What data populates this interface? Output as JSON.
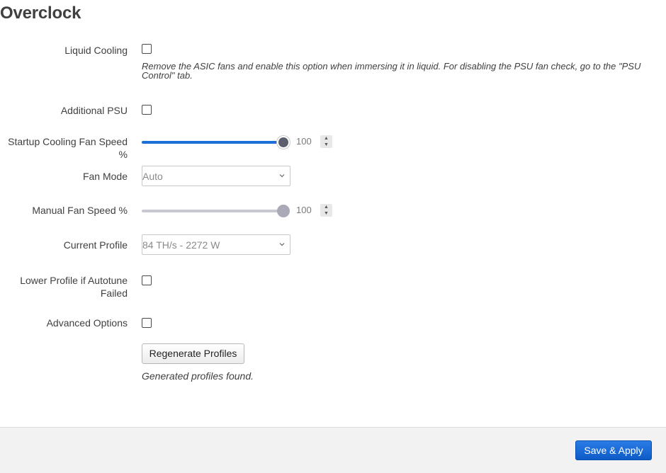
{
  "page": {
    "title": "Overclock"
  },
  "liquid_cooling": {
    "label": "Liquid Cooling",
    "checked": false,
    "description": "Remove the ASIC fans and enable this option when immersing it in liquid. For disabling the PSU fan check, go to the \"PSU Control\" tab."
  },
  "additional_psu": {
    "label": "Additional PSU",
    "checked": false
  },
  "startup_fan_speed": {
    "label": "Startup Cooling Fan Speed %",
    "value": "100",
    "level_percent": 100
  },
  "fan_mode": {
    "label": "Fan Mode",
    "selected": "Auto"
  },
  "manual_fan_speed": {
    "label": "Manual Fan Speed %",
    "value": "100",
    "level_percent": 100
  },
  "current_profile": {
    "label": "Current Profile",
    "selected": "84 TH/s - 2272 W"
  },
  "lower_profile": {
    "label_line1": "Lower Profile if Autotune",
    "label_line2": "Failed",
    "checked": false
  },
  "advanced_options": {
    "label": "Advanced Options",
    "checked": false
  },
  "regenerate": {
    "button_label": "Regenerate Profiles",
    "status": "Generated profiles found."
  },
  "footer": {
    "save_apply_label": "Save & Apply"
  },
  "colors": {
    "accent": "#1a6fd8",
    "primary_button": "#0e5bc7",
    "footer_bg": "#f2f2f2"
  }
}
